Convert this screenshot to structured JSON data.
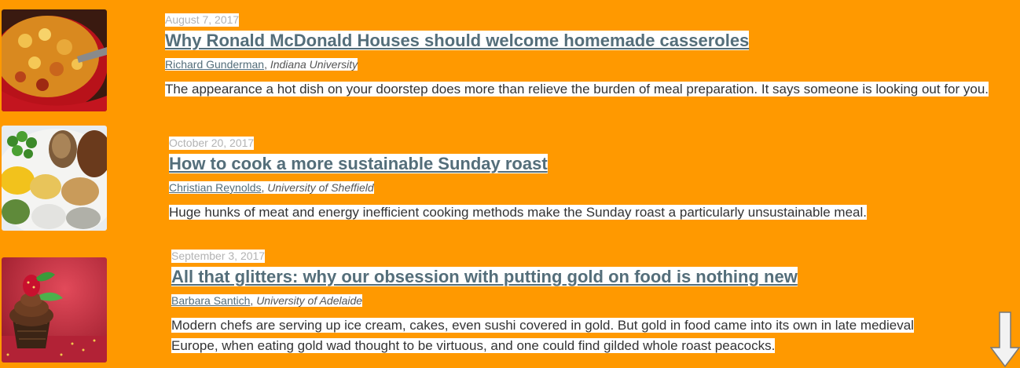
{
  "articles": [
    {
      "date": "August 7, 2017",
      "title": "Why Ronald McDonald Houses should welcome homemade casseroles",
      "author": "Richard Gunderman",
      "separator": ", ",
      "institution": "Indiana University",
      "summary": "The appearance a hot dish on your doorstep does more than relieve the burden of meal preparation. It says someone is looking out for you.",
      "image": "casserole"
    },
    {
      "date": "October 20, 2017",
      "title": "How to cook a more sustainable Sunday roast",
      "author": "Christian Reynolds",
      "separator": ", ",
      "institution": "University of Sheffield",
      "summary": "Huge hunks of meat and energy inefficient cooking methods make the Sunday roast a particularly unsustainable meal.",
      "image": "sunday-roast"
    },
    {
      "date": "September 3, 2017",
      "title": "All that glitters: why our obsession with putting gold on food is nothing new",
      "author": "Barbara Santich",
      "separator": ", ",
      "institution": "University of Adelaide",
      "summary": "Modern chefs are serving up ice cream, cakes, even sushi covered in gold. But gold in food came into its own in late medieval Europe, when eating gold wad thought to be virtuous, and one could find gilded whole roast peacocks.",
      "image": "gold-cupcake"
    }
  ],
  "scroll": {
    "icon": "arrow-down-icon"
  },
  "colors": {
    "background": "#FF9900",
    "link": "#546e7a",
    "date": "#b3b3b3",
    "text": "#333333"
  }
}
